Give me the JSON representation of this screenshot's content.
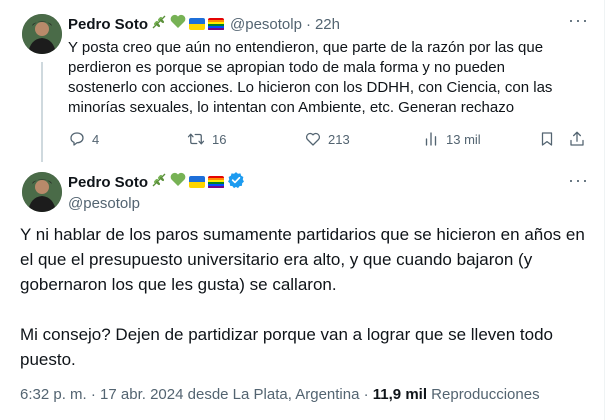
{
  "tweet1": {
    "author_name": "Pedro Soto",
    "handle": "@pesotolp",
    "separator": "·",
    "time_ago": "22h",
    "more_label": "···",
    "text": "Y posta creo que aún no entendieron, que parte de la razón por las que perdieron es porque se apropian todo de mala forma y no pueden sostenerlo con acciones. Lo hicieron con los DDHH, con Ciencia, con las minorías sexuales, lo intentan con Ambiente, etc. Generan rechazo",
    "actions": {
      "replies": "4",
      "retweets": "16",
      "likes": "213",
      "views": "13 mil"
    },
    "icons": [
      "reply-icon",
      "retweet-icon",
      "like-icon",
      "views-icon",
      "bookmark-icon",
      "share-icon"
    ]
  },
  "tweet2": {
    "author_name": "Pedro Soto",
    "handle": "@pesotolp",
    "verified": true,
    "more_label": "···",
    "paragraphs": [
      "Y ni hablar de los paros sumamente partidarios que se hicieron en años en el que el presupuesto universitario era alto, y que cuando bajaron (y gobernaron los que les gusta) se callaron.",
      "Mi consejo? Dejen de partidizar porque van a lograr que se lleven todo puesto."
    ],
    "meta": {
      "time": "6:32 p. m.",
      "dot1": "·",
      "date": "17 abr. 2024",
      "location": "desde La Plata, Argentina",
      "dot2": "·",
      "views_count": "11,9 mil",
      "views_label": "Reproducciones"
    }
  },
  "colors": {
    "text": "#0f1419",
    "muted": "#536471",
    "accent": "#1d9bf0",
    "divider": "#eff3f4",
    "thread_line": "#cfd9de"
  }
}
